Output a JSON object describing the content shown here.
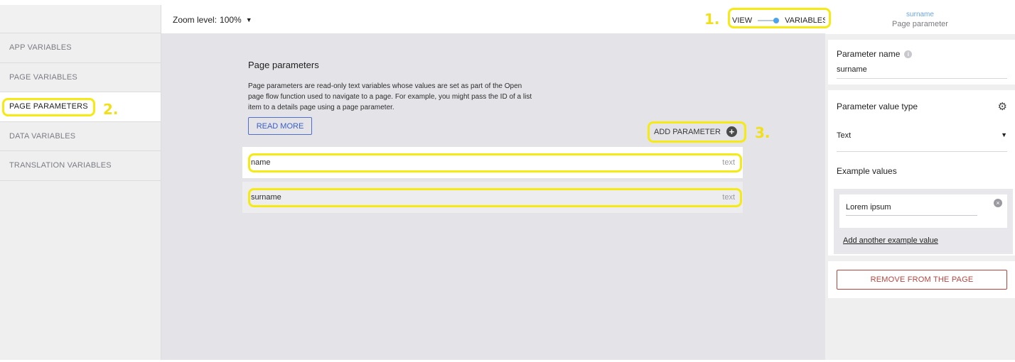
{
  "sidebar": {
    "items": [
      {
        "label": "APP VARIABLES"
      },
      {
        "label": "PAGE VARIABLES"
      },
      {
        "label": "PAGE PARAMETERS"
      },
      {
        "label": "DATA VARIABLES"
      },
      {
        "label": "TRANSLATION VARIABLES"
      }
    ],
    "active_index": 2
  },
  "topbar": {
    "zoom_label": "Zoom level:",
    "zoom_value": "100%",
    "toggle_left": "VIEW",
    "toggle_right": "VARIABLES"
  },
  "main": {
    "title": "Page parameters",
    "description": "Page parameters are read-only text variables whose values are set as part of the Open page flow function used to navigate to a page. For example, you might pass the ID of a list item to a details page using a page parameter.",
    "read_more": "READ MORE",
    "add_parameter": "ADD PARAMETER",
    "parameters": [
      {
        "name": "name",
        "type": "text"
      },
      {
        "name": "surname",
        "type": "text"
      }
    ]
  },
  "panel": {
    "header_name": "surname",
    "header_sub": "Page parameter",
    "param_name_label": "Parameter name",
    "param_name_value": "surname",
    "value_type_label": "Parameter value type",
    "value_type": "Text",
    "example_values_label": "Example values",
    "example_value": "Lorem ipsum",
    "add_example": "Add another example value",
    "remove_button": "REMOVE FROM THE PAGE"
  },
  "annotations": {
    "one": "1.",
    "two": "2.",
    "three": "3."
  },
  "colors": {
    "highlight": "#f5ea14",
    "accent_blue": "#4aa3ec",
    "danger": "#b5453f"
  }
}
